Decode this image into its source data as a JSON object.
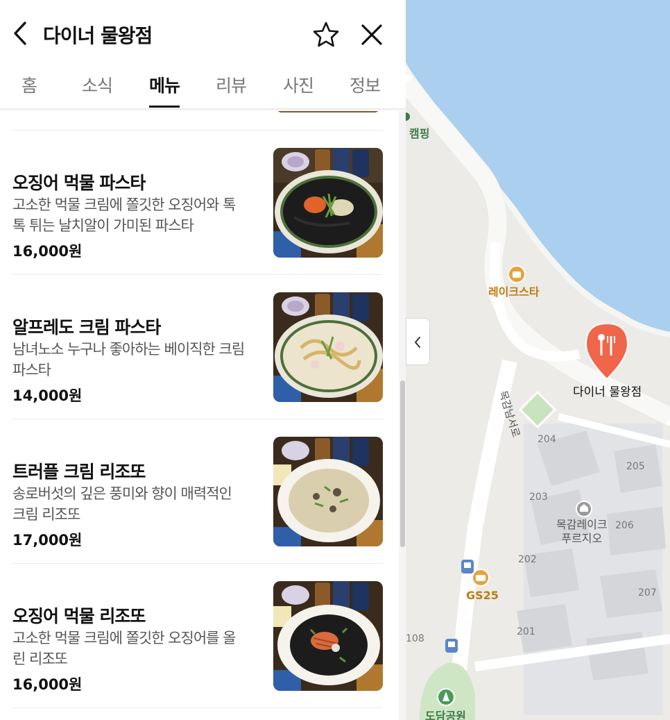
{
  "header": {
    "title": "다이너 물왕점"
  },
  "tabs": [
    {
      "label": "홈"
    },
    {
      "label": "소식"
    },
    {
      "label": "메뉴",
      "active": true
    },
    {
      "label": "리뷰"
    },
    {
      "label": "사진"
    },
    {
      "label": "정보"
    }
  ],
  "menu": [
    {
      "name": "오징어 먹물 파스타",
      "desc_line1": "고소한 먹물 크림에 쫄깃한 오징어와 톡",
      "desc_line2": "톡 튀는 날치알이 가미된 파스타",
      "price": "16,000",
      "unit": "원"
    },
    {
      "name": "알프레도 크림 파스타",
      "desc_line1": "남녀노소 누구나 좋아하는 베이직한 크림",
      "desc_line2": "파스타",
      "price": "14,000",
      "unit": "원"
    },
    {
      "name": "트러플 크림 리조또",
      "desc_line1": "송로버섯의 깊은 풍미와 향이 매력적인",
      "desc_line2": "크림 리조또",
      "price": "17,000",
      "unit": "원"
    },
    {
      "name": "오징어 먹물 리조또",
      "desc_line1": "고소한 먹물 크림에 쫄깃한 오징어를 올",
      "desc_line2": "린 리조또",
      "price": "16,000",
      "unit": "원"
    }
  ],
  "map": {
    "camping": "캠핑",
    "lakestar": "레이크스타",
    "place": "다이너 물왕점",
    "road": "목감남서로",
    "apt_line1": "목감레이크",
    "apt_line2": "푸르지오",
    "gs25": "GS25",
    "park": "도담공원",
    "numbers": [
      "204",
      "205",
      "203",
      "206",
      "202",
      "207",
      "201",
      "108"
    ]
  },
  "colors": {
    "accent": "#111111",
    "pin": "#f0664a",
    "water": "#abcfee",
    "brand_poi": "#c07b10",
    "park": "#3e7a4a"
  }
}
